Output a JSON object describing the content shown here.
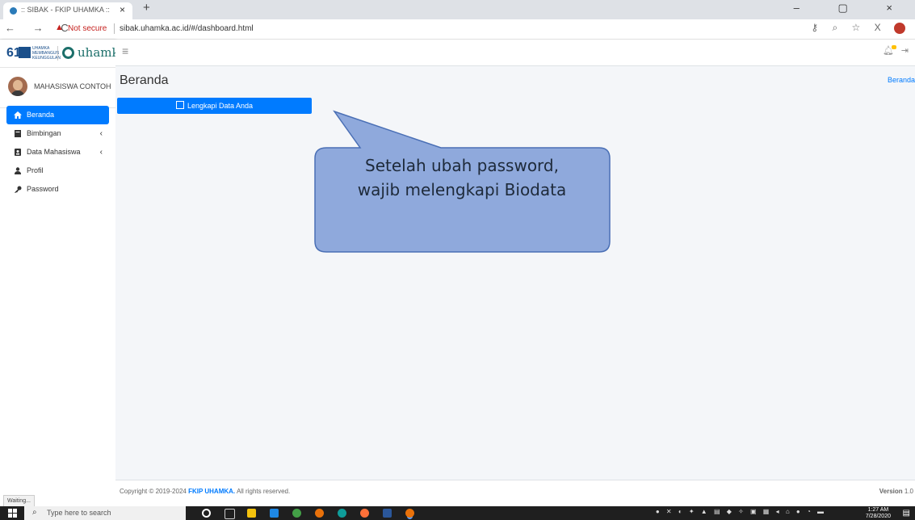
{
  "browser": {
    "tab_title": ":: SIBAK - FKIP UHAMKA ::",
    "tab_close": "×",
    "new_tab": "+",
    "window_controls": "– ▢ ×",
    "nav": "← → C",
    "not_secure": "Not secure",
    "url": "sibak.uhamka.ac.id/#/dashboard.html",
    "status_text": "Waiting..."
  },
  "brand": {
    "logo_number": "61",
    "logo_caption": "UHAMKA MEMBANGUN KEUNGGULAN",
    "logo_word": "uhamka"
  },
  "user": {
    "name": "MAHASISWA CONTOH"
  },
  "sidebar": {
    "items": [
      {
        "label": "Beranda",
        "icon": "home-icon",
        "active": true,
        "has_children": false
      },
      {
        "label": "Bimbingan",
        "icon": "book-icon",
        "active": false,
        "has_children": true
      },
      {
        "label": "Data Mahasiswa",
        "icon": "id-card-icon",
        "active": false,
        "has_children": true
      },
      {
        "label": "Profil",
        "icon": "user-icon",
        "active": false,
        "has_children": false
      },
      {
        "label": "Password",
        "icon": "key-icon",
        "active": false,
        "has_children": false
      }
    ],
    "chevron": "‹"
  },
  "topnav": {
    "menu_icon": "≡",
    "bell_icon": "bell-icon",
    "logout_icon": "logout-icon"
  },
  "main": {
    "title": "Beranda",
    "breadcrumb": "Beranda",
    "fill_button_label": "Lengkapi Data Anda"
  },
  "callout": {
    "line1": "Setelah ubah password,",
    "line2": "wajib melengkapi Biodata",
    "fill_color": "#8fa9dc",
    "stroke_color": "#4a6fb5"
  },
  "footer": {
    "copyright_prefix": "Copyright © 2019-2024",
    "copyright_org": "FKIP UHAMKA.",
    "copyright_suffix": "All rights reserved.",
    "version_label": "Version",
    "version_number": "1.0"
  },
  "taskbar": {
    "search_placeholder": "Type here to search",
    "time": "1:27 AM",
    "date": "7/28/2020"
  },
  "colors": {
    "primary": "#007bff",
    "content_bg": "#f4f6f9",
    "brand_blue": "#1a4f8b",
    "brand_teal": "#1c6f6a"
  }
}
